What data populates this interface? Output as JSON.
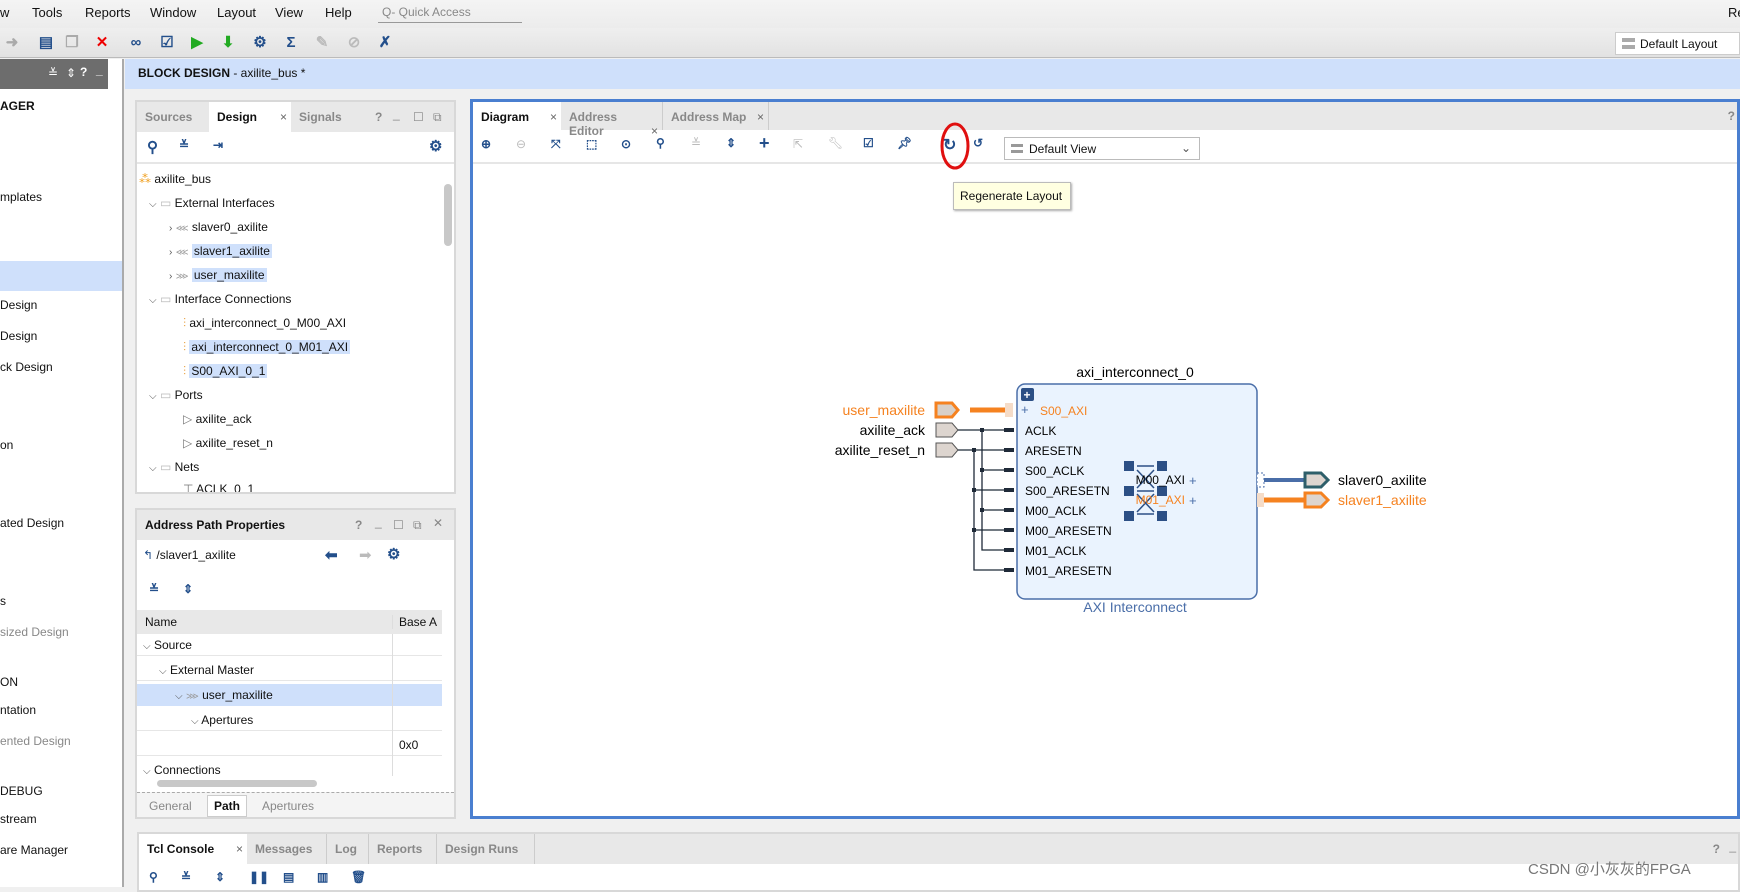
{
  "menu": [
    "w",
    "Tools",
    "Reports",
    "Window",
    "Layout",
    "View",
    "Help"
  ],
  "quick_access_placeholder": "Q- Quick Access",
  "top_right_text": "Re",
  "layout_selector": "Default Layout",
  "sidebar": {
    "items": [
      "AGER",
      "mplates",
      "Design",
      "Design",
      "ck Design",
      "on",
      "ated Design",
      "s",
      "sized Design",
      "ON",
      "ntation",
      "ented Design",
      "DEBUG",
      "stream",
      "are Manager"
    ]
  },
  "block_design": {
    "title": "BLOCK DESIGN",
    "name": " - axilite_bus *"
  },
  "design_panel": {
    "tabs": [
      "Sources",
      "Design",
      "Signals"
    ],
    "tree": [
      {
        "label": "axilite_bus"
      },
      {
        "label": "External Interfaces"
      },
      {
        "label": "slaver0_axilite"
      },
      {
        "label": "slaver1_axilite"
      },
      {
        "label": "user_maxilite"
      },
      {
        "label": "Interface Connections"
      },
      {
        "label": "axi_interconnect_0_M00_AXI"
      },
      {
        "label": "axi_interconnect_0_M01_AXI"
      },
      {
        "label": "S00_AXI_0_1"
      },
      {
        "label": "Ports"
      },
      {
        "label": "axilite_ack"
      },
      {
        "label": "axilite_reset_n"
      },
      {
        "label": "Nets"
      },
      {
        "label": "ACLK_0_1"
      }
    ]
  },
  "address_path": {
    "title": "Address Path Properties",
    "path": "/slaver1_axilite",
    "columns": [
      "Name",
      "Base A"
    ],
    "rows": [
      {
        "name": "Source",
        "base": ""
      },
      {
        "name": "External Master",
        "base": ""
      },
      {
        "name": "user_maxilite",
        "base": ""
      },
      {
        "name": "Apertures",
        "base": ""
      },
      {
        "name": "",
        "base": "0x0"
      },
      {
        "name": "Connections",
        "base": ""
      }
    ],
    "tabs": [
      "General",
      "Path",
      "Apertures"
    ]
  },
  "diagram": {
    "tabs": [
      "Diagram",
      "Address Editor",
      "Address Map"
    ],
    "view": "Default View",
    "tooltip": "Regenerate Layout",
    "block": {
      "name": "axi_interconnect_0",
      "type": "AXI Interconnect",
      "inputs": [
        "S00_AXI",
        "ACLK",
        "ARESETN",
        "S00_ACLK",
        "S00_ARESETN",
        "M00_ACLK",
        "M00_ARESETN",
        "M01_ACLK",
        "M01_ARESETN"
      ],
      "outputs": [
        "M00_AXI",
        "M01_AXI"
      ]
    },
    "ext_in": [
      "user_maxilite",
      "axilite_ack",
      "axilite_reset_n"
    ],
    "ext_out": [
      "slaver0_axilite",
      "slaver1_axilite"
    ],
    "colors": {
      "highlight": "#f58220",
      "block_fill": "#eaf3fe",
      "block_border": "#4a6ea8",
      "bus": "#4a6ea8"
    }
  },
  "console": {
    "tabs": [
      "Tcl Console",
      "Messages",
      "Log",
      "Reports",
      "Design Runs"
    ]
  },
  "watermark": "CSDN @小灰灰的FPGA"
}
